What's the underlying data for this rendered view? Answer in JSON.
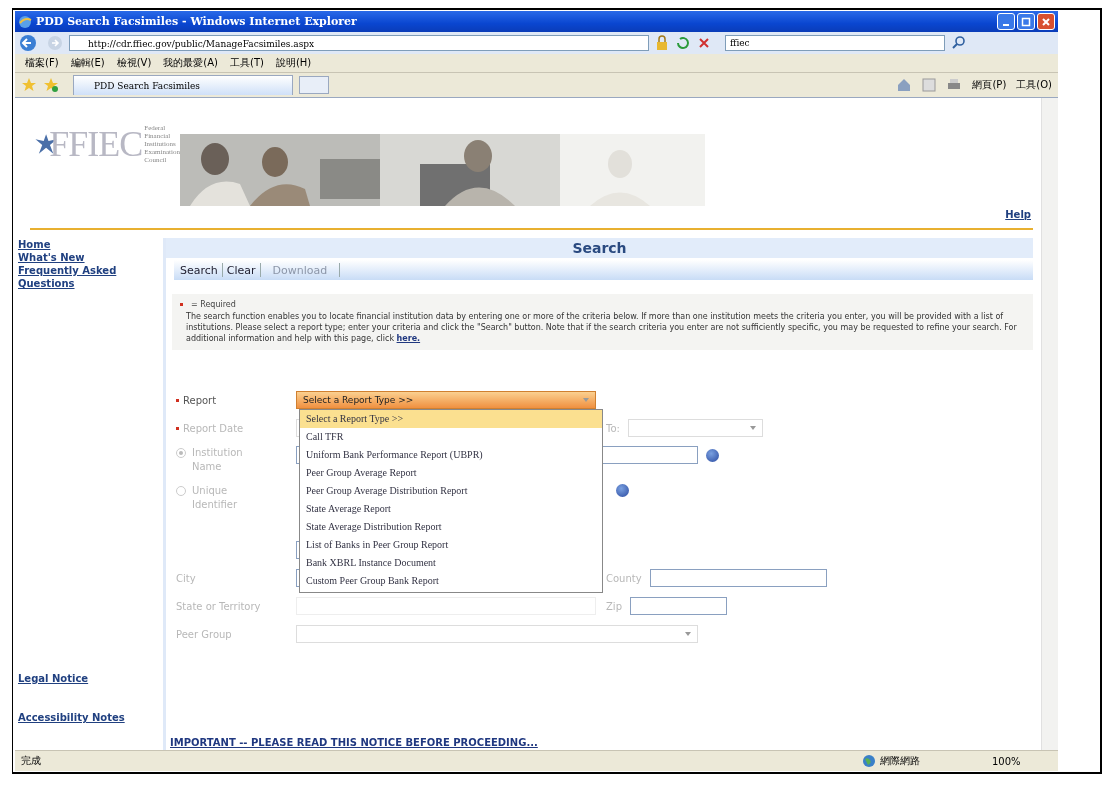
{
  "window": {
    "title": "PDD Search Facsimiles - Windows Internet Explorer"
  },
  "address_bar": {
    "url": "http://cdr.ffiec.gov/public/ManageFacsimiles.aspx",
    "search": "ffiec"
  },
  "menu": [
    "檔案(F)",
    "編輯(E)",
    "檢視(V)",
    "我的最愛(A)",
    "工具(T)",
    "說明(H)"
  ],
  "tab": {
    "label": "PDD Search Facsimiles",
    "selected": true
  },
  "command_bar": {
    "page": "網頁(P)",
    "tools": "工具(O)"
  },
  "header": {
    "logo_text": "FFIEC",
    "org_name": "Federal Financial Institutions Examination Council",
    "help": "Help"
  },
  "nav": {
    "top": [
      "Home",
      "What's New",
      "Frequently Asked Questions"
    ],
    "bottom": [
      "Legal Notice",
      "Accessibility Notes"
    ]
  },
  "page_title": "Search",
  "actions": [
    {
      "label": "Search",
      "disabled": false
    },
    {
      "label": "Clear",
      "disabled": false
    },
    {
      "label": "Download",
      "disabled": true
    }
  ],
  "info": {
    "required_note": "= Required",
    "text": "The search function enables you to locate financial institution data by entering one or more of the criteria below. If more than one institution meets the criteria you enter, you will be provided with a list of institutions. Please select a report type; enter your criteria and click the \"Search\" button. Note that if the search criteria you enter are not sufficiently specific, you may be requested to refine your search. For additional information and help with this page, click",
    "link": "here."
  },
  "form": {
    "report": {
      "label": "Report",
      "required": true,
      "value": "Select a Report Type >>",
      "expanded": true,
      "options": [
        {
          "label": "Select a Report Type >>",
          "selected": true
        },
        {
          "label": "Call TFR",
          "selected": false
        },
        {
          "label": "Uniform Bank Performance Report (UBPR)",
          "selected": false
        },
        {
          "label": "Peer Group Average Report",
          "selected": false
        },
        {
          "label": "Peer Group Average Distribution Report",
          "selected": false
        },
        {
          "label": "State Average Report",
          "selected": false
        },
        {
          "label": "State Average Distribution Report",
          "selected": false
        },
        {
          "label": "List of Banks in Peer Group Report",
          "selected": false
        },
        {
          "label": "Bank XBRL Instance Document",
          "selected": false
        },
        {
          "label": "Custom Peer Group Bank Report",
          "selected": false
        }
      ]
    },
    "report_date": {
      "label": "Report Date",
      "required": true,
      "disabled": true,
      "to_label": "To:"
    },
    "identify_by": [
      {
        "label": "Institution Name",
        "selected": true,
        "disabled": true
      },
      {
        "label": "Unique Identifier",
        "selected": false,
        "disabled": true
      }
    ],
    "city": {
      "label": "City",
      "disabled": true
    },
    "county": {
      "label": "County",
      "disabled": true
    },
    "state": {
      "label": "State or Territory",
      "disabled": true
    },
    "zip": {
      "label": "Zip",
      "disabled": true
    },
    "peer_group": {
      "label": "Peer Group",
      "disabled": true
    }
  },
  "notice_link": "IMPORTANT -- PLEASE READ THIS NOTICE BEFORE PROCEEDING...",
  "status_bar": {
    "text": "完成",
    "zone": "網際網路",
    "zoom": "100%"
  }
}
